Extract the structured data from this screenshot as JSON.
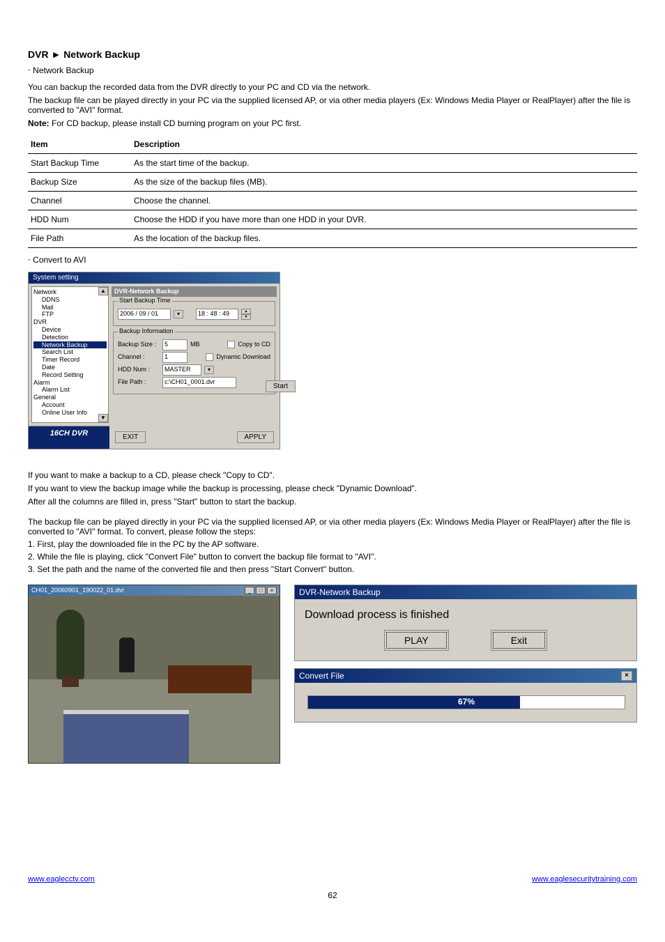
{
  "section_heading_1": "DVR ► Network Backup",
  "section1_bullet": "‧ Network Backup",
  "section1_desc_a": "You can backup the recorded data from the DVR directly to your PC and CD via the network.",
  "section1_desc_b": "The backup file can be played directly in your PC via the supplied licensed AP, or via other media players (Ex: Windows Media Player or RealPlayer) after the file is converted to \"AVI\" format.",
  "note_prefix": "Note:",
  "section1_note": "For CD backup, please install CD burning program on your PC first.",
  "params_table": {
    "headers": [
      "Item",
      "Description"
    ],
    "rows": [
      [
        "Start Backup Time",
        "As the start time of the backup."
      ],
      [
        "Backup Size",
        "As the size of the backup files (MB)."
      ],
      [
        "Channel",
        "Choose the channel."
      ],
      [
        "HDD Num",
        "Choose the HDD if you have more than one HDD in your DVR."
      ],
      [
        "File Path",
        "As the location of the backup files."
      ]
    ]
  },
  "section2_bullet": "‧ Convert to AVI",
  "systemsetting_window": {
    "title": "System setting",
    "tree": {
      "items": [
        {
          "label": "Network",
          "indent": 0
        },
        {
          "label": "DDNS",
          "indent": 1
        },
        {
          "label": "Mail",
          "indent": 1
        },
        {
          "label": "FTP",
          "indent": 1
        },
        {
          "label": "DVR",
          "indent": 0
        },
        {
          "label": "Device",
          "indent": 1
        },
        {
          "label": "Detection",
          "indent": 1
        },
        {
          "label": "Network Backup",
          "indent": 1,
          "selected": true
        },
        {
          "label": "Search List",
          "indent": 1
        },
        {
          "label": "Timer Record",
          "indent": 1
        },
        {
          "label": "Date",
          "indent": 1
        },
        {
          "label": "Record Setting",
          "indent": 1
        },
        {
          "label": "Alarm",
          "indent": 0
        },
        {
          "label": "Alarm List",
          "indent": 1
        },
        {
          "label": "General",
          "indent": 0
        },
        {
          "label": "Account",
          "indent": 1
        },
        {
          "label": "Online User Info",
          "indent": 1
        }
      ]
    },
    "panel_title": "DVR-Network Backup",
    "group1_title": "Start Backup Time",
    "date_value": "2006 / 09 / 01",
    "time_value": "18 : 48 : 49",
    "group2_title": "Backup Information",
    "backup_size_label": "Backup Size :",
    "backup_size_value": "5",
    "mb_label": "MB",
    "copy_cd_label": "Copy to CD",
    "channel_label": "Channel :",
    "channel_value": "1",
    "dyn_label": "Dynamic Download",
    "hdd_label": "HDD Num :",
    "hdd_value": "MASTER",
    "filepath_label": "File Path :",
    "filepath_value": "c:\\CH01_0001.dvr",
    "start_btn": "Start",
    "logo": "16CH DVR",
    "exit_btn": "EXIT",
    "apply_btn": "APPLY"
  },
  "post_text_line1": "If you want to make a backup to a CD, please check \"Copy to CD\".",
  "post_text_line2": "If you want to view the backup image while the backup is processing, please check \"Dynamic Download\".",
  "post_text_line3": "After all the columns are filled in, press \"Start\" button to start the backup.",
  "steps": [
    "The backup file can be played directly in your PC via the supplied licensed AP, or via other media players (Ex: Windows Media Player or RealPlayer) after the file is converted to \"AVI\" format. To convert, please follow the steps:",
    "1. First, play the downloaded file in the PC by the AP software.",
    "2. While the file is playing, click \"Convert File\" button to convert the backup file format to \"AVI\".",
    "3. Set the path and the name of the converted file and then press \"Start Convert\" button."
  ],
  "video_window_title": "CH01_20060901_190022_01.dvr",
  "download_popup": {
    "title": "DVR-Network Backup",
    "message": "Download process is finished",
    "play_btn": "PLAY",
    "exit_btn": "Exit"
  },
  "convert_popup": {
    "title": "Convert File",
    "percent": "67%",
    "fill_width": 67
  },
  "footer_left": "www.eaglecctv.com",
  "footer_right": "www.eaglesecuritytraining.com",
  "page_number": "62"
}
